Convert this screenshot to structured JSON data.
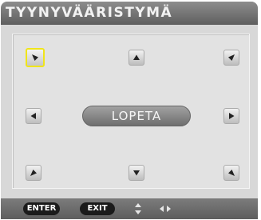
{
  "dialog": {
    "title": "TYYNYVÄÄRISTYMÄ",
    "center_button_label": "LOPETA",
    "corner_buttons": [
      {
        "name": "top-left",
        "icon": "triangle-pointing-down-right",
        "selected": true
      },
      {
        "name": "top-center",
        "icon": "triangle-pointing-up",
        "selected": false
      },
      {
        "name": "top-right",
        "icon": "triangle-pointing-down-left",
        "selected": false
      },
      {
        "name": "middle-left",
        "icon": "triangle-pointing-left",
        "selected": false
      },
      {
        "name": "middle-right",
        "icon": "triangle-pointing-right",
        "selected": false
      },
      {
        "name": "bottom-left",
        "icon": "triangle-pointing-up-right",
        "selected": false
      },
      {
        "name": "bottom-center",
        "icon": "triangle-pointing-down",
        "selected": false
      },
      {
        "name": "bottom-right",
        "icon": "triangle-pointing-up-left",
        "selected": false
      }
    ],
    "colors": {
      "selection_outline": "#f0e51a",
      "title_bar": "#6e6e6e",
      "background": "#d8d8d8"
    }
  },
  "footer": {
    "enter_label": "ENTER",
    "exit_label": "EXIT",
    "updown_icon": "up-down-arrows-icon",
    "leftright_icon": "left-right-arrows-icon"
  }
}
